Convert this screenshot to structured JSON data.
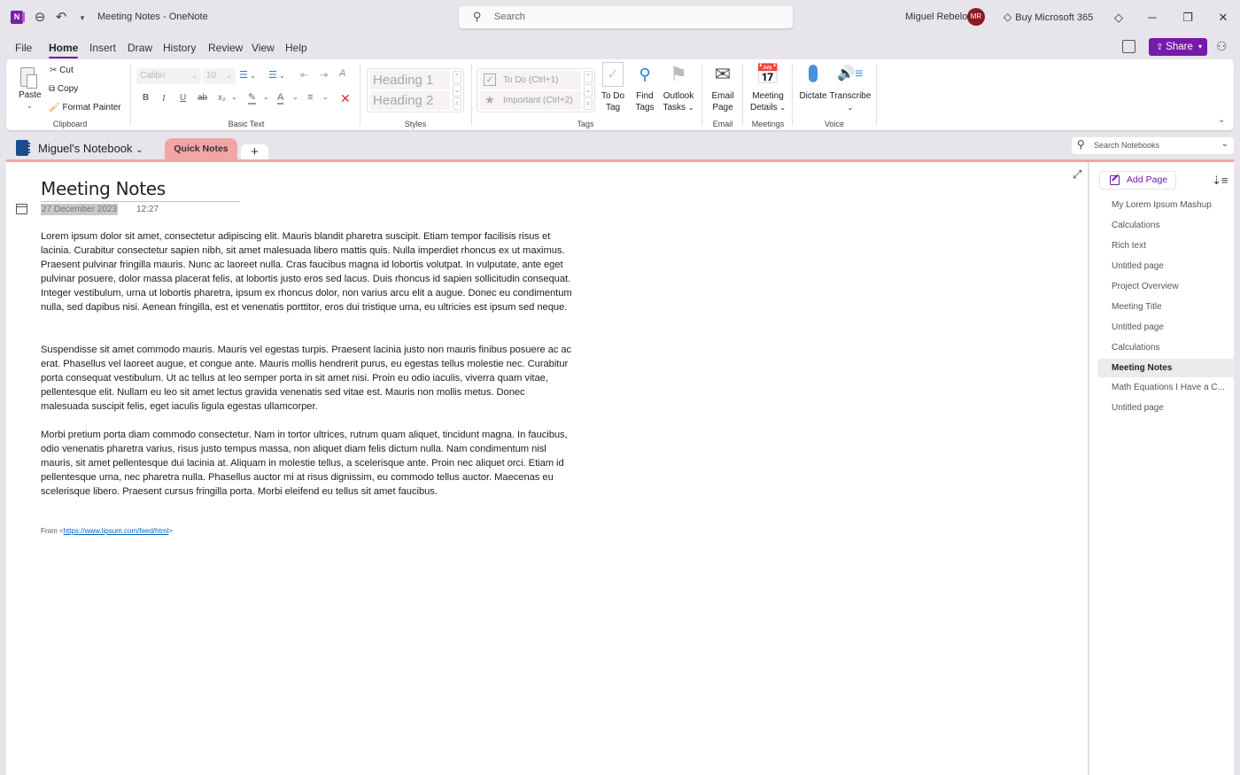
{
  "window": {
    "title": "Meeting Notes  -  OneNote",
    "app_icon_letter": "N",
    "search_placeholder": "Search",
    "user_name": "Miguel Rebelo",
    "user_initials": "MR",
    "buy_label": "Buy Microsoft 365"
  },
  "menu": {
    "tabs": [
      "File",
      "Home",
      "Insert",
      "Draw",
      "History",
      "Review",
      "View",
      "Help"
    ],
    "active": "Home",
    "share_label": "Share"
  },
  "ribbon": {
    "clipboard": {
      "paste": "Paste",
      "cut": "Cut",
      "copy": "Copy",
      "format_painter": "Format Painter",
      "label": "Clipboard"
    },
    "basic_text": {
      "font": "Calibri",
      "size": "10",
      "label": "Basic Text",
      "bold": "B",
      "italic": "I",
      "underline": "U",
      "strike": "ab",
      "subscript": "x₂"
    },
    "styles": {
      "items": [
        "Heading 1",
        "Heading 2"
      ],
      "label": "Styles"
    },
    "tags": {
      "items": [
        "To Do (Ctrl+1)",
        "Important (Ctrl+2)"
      ],
      "todo_tag": [
        "To Do",
        "Tag"
      ],
      "find_tags": [
        "Find",
        "Tags"
      ],
      "outlook_tasks": [
        "Outlook",
        "Tasks"
      ],
      "label": "Tags"
    },
    "email": {
      "btn": [
        "Email",
        "Page"
      ],
      "label": "Email"
    },
    "meetings": {
      "btn": [
        "Meeting",
        "Details"
      ],
      "label": "Meetings"
    },
    "voice": {
      "dictate": "Dictate",
      "transcribe": "Transcribe",
      "label": "Voice"
    }
  },
  "notebook": {
    "name": "Miguel's Notebook",
    "section": "Quick Notes",
    "add_section": "+",
    "search_placeholder": "Search Notebooks",
    "section_color": "#f2a5a5"
  },
  "page": {
    "title": "Meeting Notes",
    "date": "27 December 2023",
    "time": "12:27",
    "paragraphs": [
      "Lorem ipsum dolor sit amet, consectetur adipiscing elit. Mauris blandit pharetra suscipit. Etiam tempor facilisis risus et lacinia. Curabitur consectetur sapien nibh, sit amet malesuada libero mattis quis. Nulla imperdiet rhoncus ex ut maximus. Praesent pulvinar fringilla mauris. Nunc ac laoreet nulla. Cras faucibus magna id lobortis volutpat. In vulputate, ante eget pulvinar posuere, dolor massa placerat felis, at lobortis justo eros sed lacus. Duis rhoncus id sapien sollicitudin consequat. Integer vestibulum, urna ut lobortis pharetra, ipsum ex rhoncus dolor, non varius arcu elit a augue. Donec eu condimentum nulla, sed dapibus nisi. Aenean fringilla, est et venenatis porttitor, eros dui tristique urna, eu ultricies est ipsum sed neque.",
      "Suspendisse sit amet commodo mauris. Mauris vel egestas turpis. Praesent lacinia justo non mauris finibus posuere ac ac erat. Phasellus vel laoreet augue, et congue ante. Mauris mollis hendrerit purus, eu egestas tellus molestie nec. Curabitur porta consequat vestibulum. Ut ac tellus at leo semper porta in sit amet nisi. Proin eu odio iaculis, viverra quam vitae, pellentesque elit. Nullam eu leo sit amet lectus gravida venenatis sed vitae est. Mauris non mollis metus. Donec malesuada suscipit felis, eget iaculis ligula egestas ullamcorper.",
      "Morbi pretium porta diam commodo consectetur. Nam in tortor ultrices, rutrum quam aliquet, tincidunt magna. In faucibus, odio venenatis pharetra varius, risus justo tempus massa, non aliquet diam felis dictum nulla. Nam condimentum nisl mauris, sit amet pellentesque dui lacinia at. Aliquam in molestie tellus, a scelerisque ante. Proin nec aliquet orci. Etiam id pellentesque urna, nec pharetra nulla. Phasellus auctor mi at risus dignissim, eu commodo tellus auctor. Maecenas eu scelerisque libero. Praesent cursus fringilla porta. Morbi eleifend eu tellus sit amet faucibus."
    ],
    "source_prefix": "From <",
    "source_link": "https://www.lipsum.com/feed/html",
    "source_suffix": ">"
  },
  "pages_panel": {
    "add_page": "Add Page",
    "items": [
      "My Lorem Ipsum Mashup",
      "Calculations",
      "Rich text",
      "Untitled page",
      "Project Overview",
      "Meeting Title",
      "Untitled page",
      "Calculations",
      "Meeting Notes",
      "Math Equations I Have a C...",
      "Untitled page"
    ],
    "selected_index": 8
  },
  "colors": {
    "accent": "#7719aa",
    "avatar": "#8e1a22"
  }
}
